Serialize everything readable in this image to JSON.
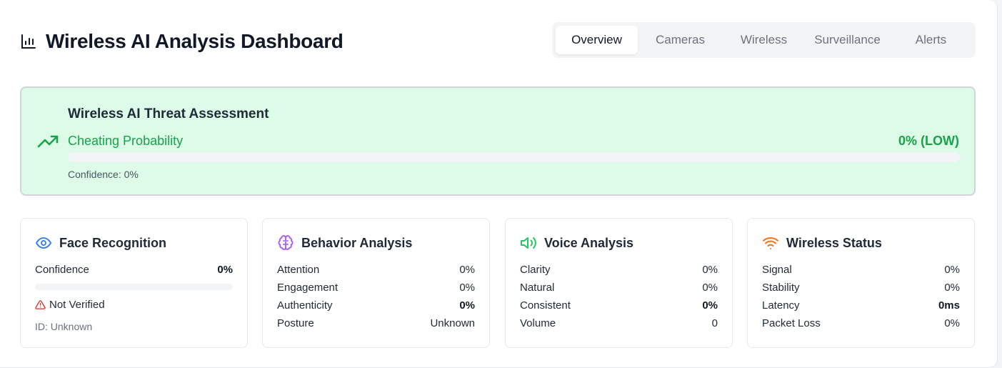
{
  "header": {
    "title": "Wireless AI Analysis Dashboard",
    "icon": "bar-chart-icon"
  },
  "tabs": [
    {
      "label": "Overview",
      "active": true
    },
    {
      "label": "Cameras",
      "active": false
    },
    {
      "label": "Wireless",
      "active": false
    },
    {
      "label": "Surveillance",
      "active": false
    },
    {
      "label": "Alerts",
      "active": false
    }
  ],
  "threat": {
    "title": "Wireless AI Threat Assessment",
    "label": "Cheating Probability",
    "value": "0% (LOW)",
    "probability": 0,
    "confidence": "Confidence: 0%",
    "icon": "trending-up-icon",
    "color": "#16a34a",
    "background": "#dcfce7"
  },
  "face": {
    "title": "Face Recognition",
    "icon": "eye-icon",
    "icon_color": "#3b82f6",
    "confidence_label": "Confidence",
    "confidence_value": "0%",
    "confidence_level": 0,
    "status": "Not Verified",
    "status_icon": "warning-icon",
    "id": "ID: Unknown"
  },
  "behavior": {
    "title": "Behavior Analysis",
    "icon": "brain-icon",
    "icon_color": "#a855f7",
    "rows": [
      {
        "label": "Attention",
        "value": "0%"
      },
      {
        "label": "Engagement",
        "value": "0%"
      },
      {
        "label": "Authenticity",
        "value": "0%"
      },
      {
        "label": "Posture",
        "value": "Unknown"
      }
    ]
  },
  "voice": {
    "title": "Voice Analysis",
    "icon": "volume-icon",
    "icon_color": "#22c55e",
    "rows": [
      {
        "label": "Clarity",
        "value": "0%"
      },
      {
        "label": "Natural",
        "value": "0%"
      },
      {
        "label": "Consistent",
        "value": "0%"
      },
      {
        "label": "Volume",
        "value": "0"
      }
    ]
  },
  "wireless": {
    "title": "Wireless Status",
    "icon": "wifi-icon",
    "icon_color": "#f97316",
    "rows": [
      {
        "label": "Signal",
        "value": "0%"
      },
      {
        "label": "Stability",
        "value": "0%"
      },
      {
        "label": "Latency",
        "value": "0ms"
      },
      {
        "label": "Packet Loss",
        "value": "0%"
      }
    ]
  }
}
